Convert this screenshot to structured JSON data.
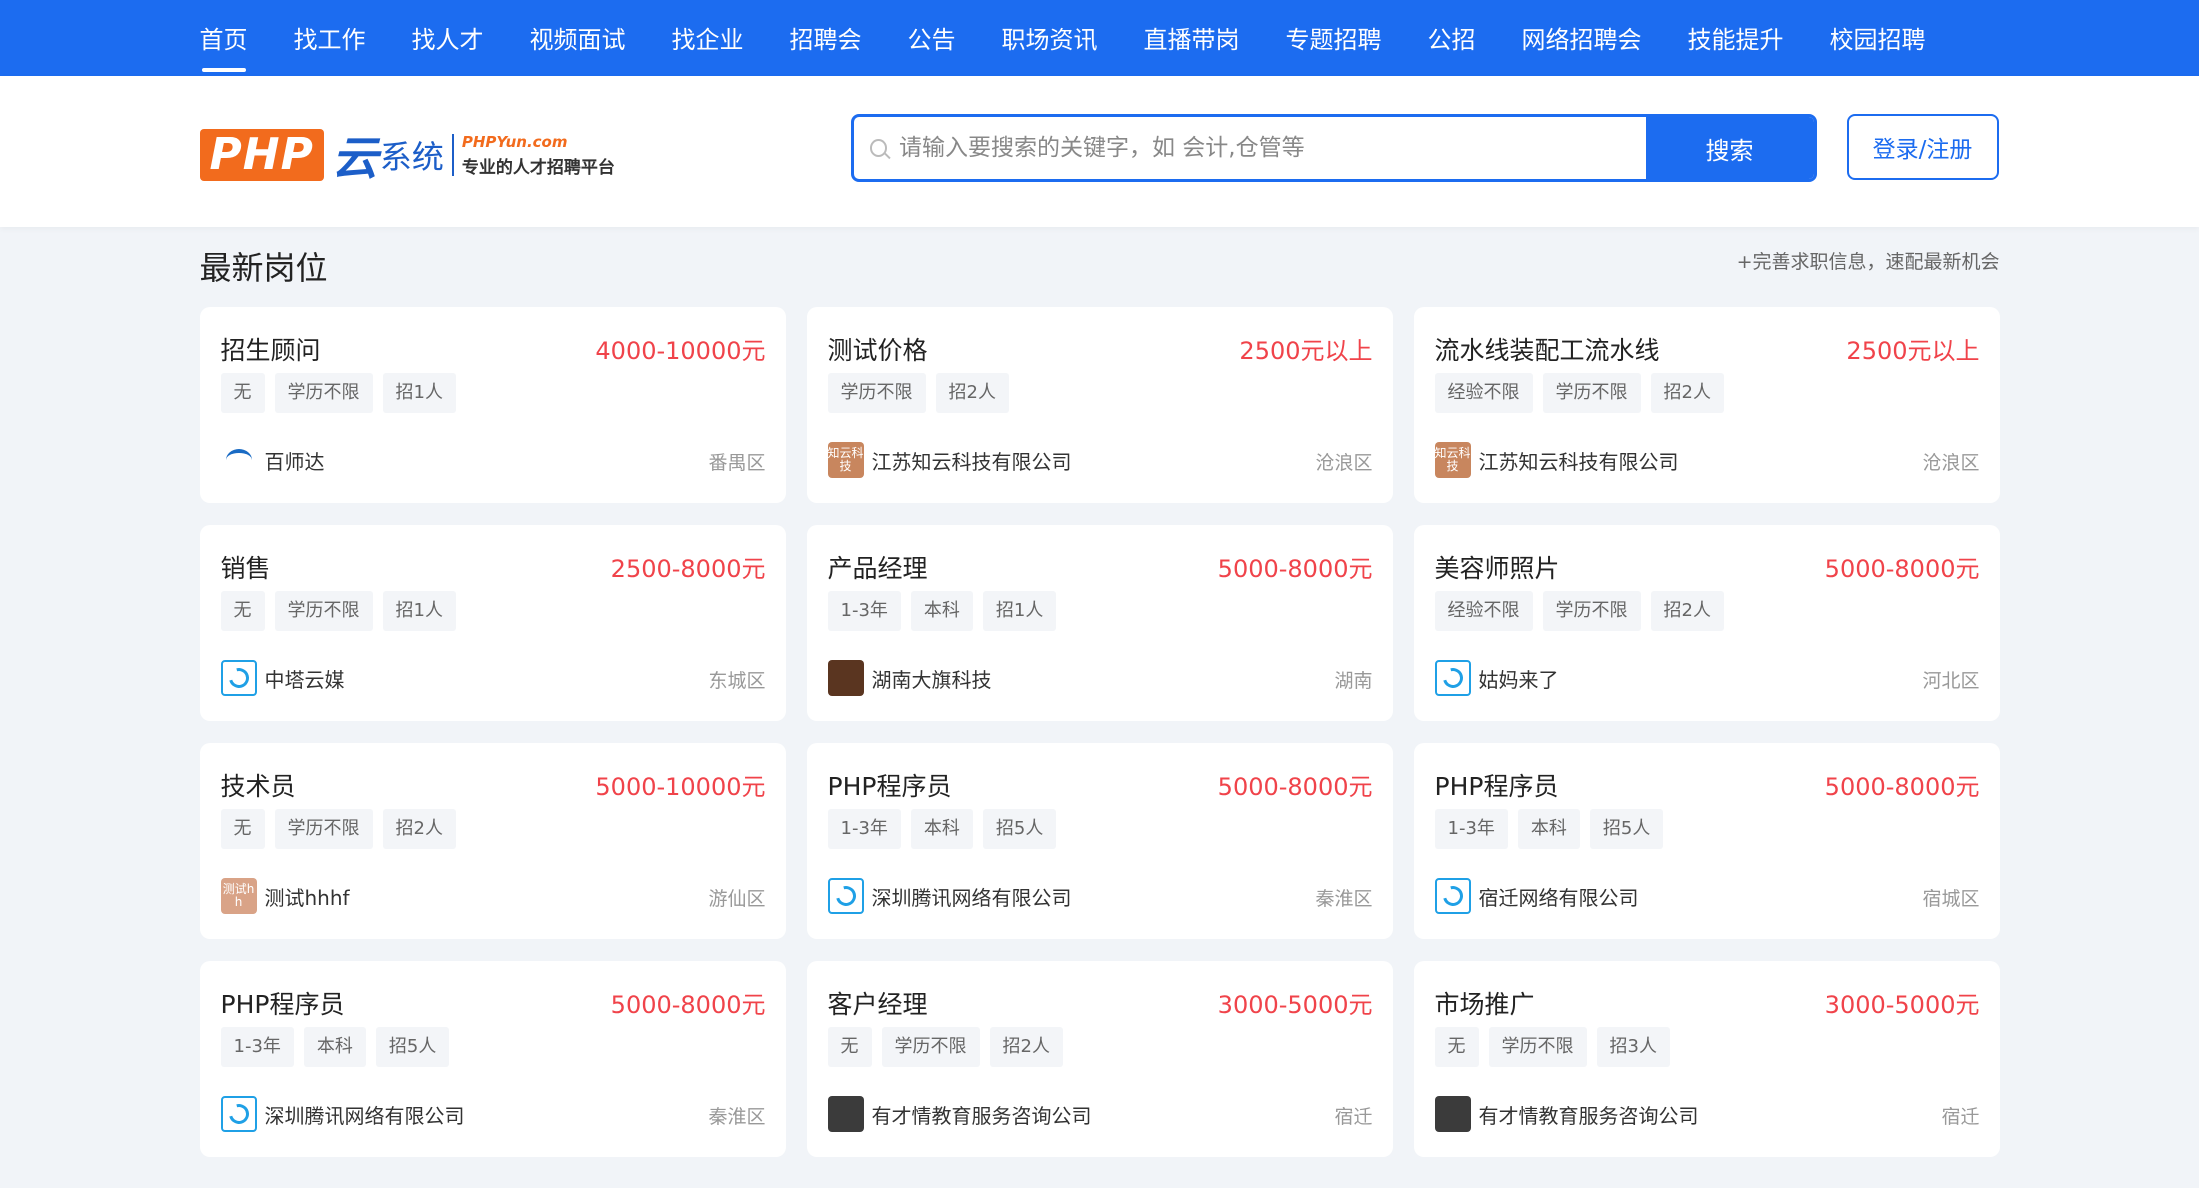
{
  "nav": {
    "items": [
      "首页",
      "找工作",
      "找人才",
      "视频面试",
      "找企业",
      "招聘会",
      "公告",
      "职场资讯",
      "直播带岗",
      "专题招聘",
      "公招",
      "网络招聘会",
      "技能提升",
      "校园招聘"
    ]
  },
  "header": {
    "logo_php": "PHP",
    "logo_yun": "云",
    "logo_sys": "系统",
    "logo_domain": "PHPYun.com",
    "logo_slogan": "专业的人才招聘平台",
    "search_placeholder": "请输入要搜索的关键字，如 会计,仓管等",
    "search_button": "搜索",
    "login_button": "登录/注册"
  },
  "section": {
    "title": "最新岗位",
    "more": "+完善求职信息，速配最新机会"
  },
  "jobs": [
    {
      "title": "招生顾问",
      "salary": "4000-10000元",
      "tags": [
        "无",
        "学历不限",
        "招1人"
      ],
      "company": "百师达",
      "area": "番禺区",
      "logo_type": "baishida",
      "logo_text": ""
    },
    {
      "title": "测试价格",
      "salary": "2500元以上",
      "tags": [
        "学历不限",
        "招2人"
      ],
      "company": "江苏知云科技有限公司",
      "area": "沧浪区",
      "logo_type": "zhiyun",
      "logo_text": "知云科技"
    },
    {
      "title": "流水线装配工流水线",
      "salary": "2500元以上",
      "tags": [
        "经验不限",
        "学历不限",
        "招2人"
      ],
      "company": "江苏知云科技有限公司",
      "area": "沧浪区",
      "logo_type": "zhiyun",
      "logo_text": "知云科技"
    },
    {
      "title": "销售",
      "salary": "2500-8000元",
      "tags": [
        "无",
        "学历不限",
        "招1人"
      ],
      "company": "中塔云媒",
      "area": "东城区",
      "logo_type": "blue",
      "logo_text": ""
    },
    {
      "title": "产品经理",
      "salary": "5000-8000元",
      "tags": [
        "1-3年",
        "本科",
        "招1人"
      ],
      "company": "湖南大旗科技",
      "area": "湖南",
      "logo_type": "brown",
      "logo_text": ""
    },
    {
      "title": "美容师照片",
      "salary": "5000-8000元",
      "tags": [
        "经验不限",
        "学历不限",
        "招2人"
      ],
      "company": "姑妈来了",
      "area": "河北区",
      "logo_type": "blue",
      "logo_text": ""
    },
    {
      "title": "技术员",
      "salary": "5000-10000元",
      "tags": [
        "无",
        "学历不限",
        "招2人"
      ],
      "company": "测试hhhf",
      "area": "游仙区",
      "logo_type": "test",
      "logo_text": "测试h h"
    },
    {
      "title": "PHP程序员",
      "salary": "5000-8000元",
      "tags": [
        "1-3年",
        "本科",
        "招5人"
      ],
      "company": "深圳腾讯网络有限公司",
      "area": "秦淮区",
      "logo_type": "blue",
      "logo_text": ""
    },
    {
      "title": "PHP程序员",
      "salary": "5000-8000元",
      "tags": [
        "1-3年",
        "本科",
        "招5人"
      ],
      "company": "宿迁网络有限公司",
      "area": "宿城区",
      "logo_type": "blue",
      "logo_text": ""
    },
    {
      "title": "PHP程序员",
      "salary": "5000-8000元",
      "tags": [
        "1-3年",
        "本科",
        "招5人"
      ],
      "company": "深圳腾讯网络有限公司",
      "area": "秦淮区",
      "logo_type": "blue",
      "logo_text": ""
    },
    {
      "title": "客户经理",
      "salary": "3000-5000元",
      "tags": [
        "无",
        "学历不限",
        "招2人"
      ],
      "company": "有才情教育服务咨询公司",
      "area": "宿迁",
      "logo_type": "dark",
      "logo_text": ""
    },
    {
      "title": "市场推广",
      "salary": "3000-5000元",
      "tags": [
        "无",
        "学历不限",
        "招3人"
      ],
      "company": "有才情教育服务咨询公司",
      "area": "宿迁",
      "logo_type": "dark",
      "logo_text": ""
    }
  ]
}
